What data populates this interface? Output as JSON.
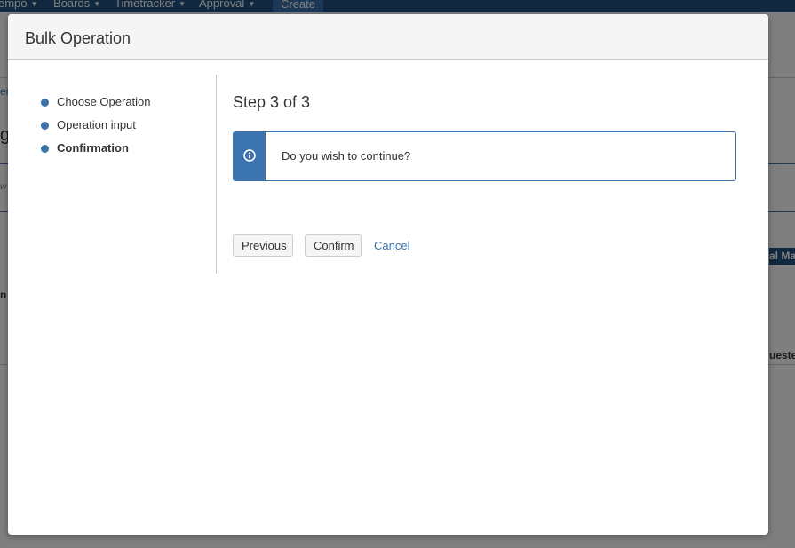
{
  "background": {
    "nav_items": [
      "empo",
      "Boards",
      "Timetracker",
      "Approval"
    ],
    "create_label": "Create",
    "fragments": {
      "link": "en",
      "heading": "g",
      "hint": "w",
      "label": "n",
      "button": "al Ma",
      "status": "ueste"
    }
  },
  "dialog": {
    "title": "Bulk Operation",
    "steps": [
      {
        "label": "Choose Operation",
        "active": false
      },
      {
        "label": "Operation input",
        "active": false
      },
      {
        "label": "Confirmation",
        "active": true
      }
    ],
    "step_heading": "Step 3 of 3",
    "message": "Do you wish to continue?",
    "buttons": {
      "previous": "Previous",
      "confirm": "Confirm",
      "cancel": "Cancel"
    }
  },
  "colors": {
    "accent": "#3b73af",
    "nav": "#205081",
    "header_bg": "#f5f5f5"
  },
  "icons": {
    "info": "info-circle-icon",
    "step_marker": "dot"
  }
}
